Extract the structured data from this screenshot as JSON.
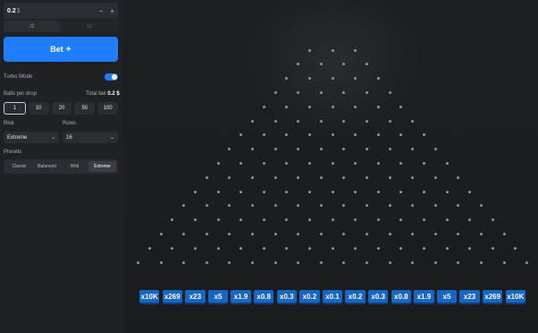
{
  "bet_amount": {
    "value": "0.2",
    "currency": "$",
    "decrement_icon": "minus-icon",
    "increment_icon": "plus-icon"
  },
  "half_label": "/2",
  "double_label": "x2",
  "bet_button": {
    "label": "Bet",
    "icon": "rocket-icon"
  },
  "turbo": {
    "label": "Turbo Mode",
    "enabled": true
  },
  "balls_per_drop": {
    "label": "Balls per drop",
    "options": [
      "1",
      "10",
      "20",
      "50",
      "100"
    ],
    "selected": "1"
  },
  "total_bet": {
    "label": "Total bet",
    "value": "0.2 $"
  },
  "risk": {
    "label": "Risk",
    "value": "Extreme"
  },
  "rows": {
    "label": "Rows",
    "value": "16"
  },
  "presets": {
    "label": "Presets",
    "options": [
      "Classic",
      "Balanced",
      "Wild",
      "Extreme"
    ],
    "selected": "Extreme"
  },
  "board": {
    "peg_rows": 16,
    "multipliers": [
      "x10K",
      "x269",
      "x23",
      "x5",
      "x1.9",
      "x0.8",
      "x0.3",
      "x0.2",
      "x0.1",
      "x0.2",
      "x0.3",
      "x0.8",
      "x1.9",
      "x5",
      "x23",
      "x269",
      "x10K"
    ]
  },
  "colors": {
    "accent": "#1f7dff",
    "multiplier_bg": "#1666c5",
    "panel_bg": "#1f2124",
    "peg": "#8e9399"
  }
}
